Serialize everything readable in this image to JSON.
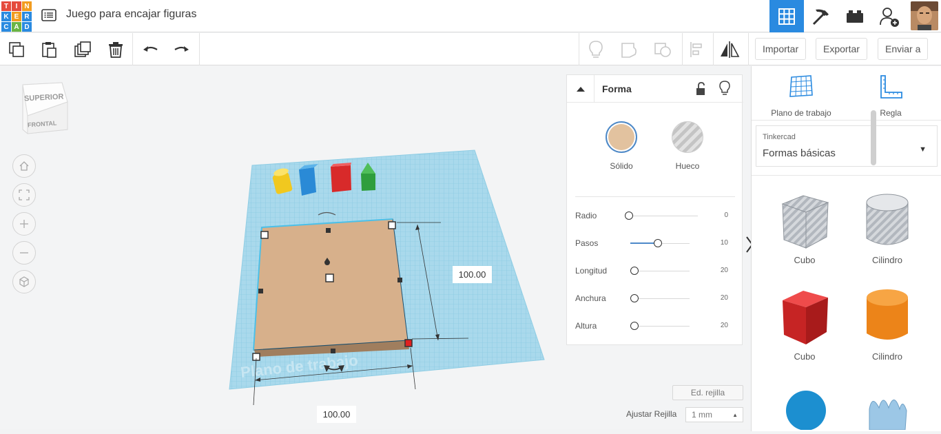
{
  "app": {
    "logo_letters": [
      "T",
      "I",
      "N",
      "K",
      "E",
      "R",
      "C",
      "A",
      "D"
    ],
    "logo_colors": [
      "#e54b3d",
      "#e54b3d",
      "#e54b3d",
      "#2a8ae0",
      "#2a8ae0",
      "#2a8ae0",
      "#2a8ae0",
      "#2a8ae0",
      "#2a8ae0"
    ],
    "title": "Juego para encajar figuras",
    "accent": "#2a8ae0"
  },
  "topbar": {
    "icons": [
      "list-icon",
      "grid-view-icon",
      "pickaxe-icon",
      "bricks-icon",
      "add-user-icon",
      "avatar"
    ]
  },
  "toolbar": {
    "left_icons": [
      "copy-icon",
      "paste-icon",
      "duplicate-icon",
      "delete-icon",
      "undo-icon",
      "redo-icon"
    ],
    "right_icons": [
      "lightbulb-icon",
      "group-icon",
      "ungroup-icon",
      "align-icon",
      "mirror-icon"
    ],
    "import_label": "Importar",
    "export_label": "Exportar",
    "send_label": "Enviar a"
  },
  "viewcube": {
    "top_label": "SUPERIOR",
    "front_label": "FRONTAL"
  },
  "workspace": {
    "plane_label": "Plano de trabajo",
    "width_value": "100.00",
    "length_value": "100.00",
    "shape_color": "#d9b38c"
  },
  "shape_panel": {
    "title": "Forma",
    "solid_label": "Sólido",
    "hole_label": "Hueco",
    "solid_color": "#e2c29f",
    "params": [
      {
        "label": "Radio",
        "value": "0",
        "level": 0.0
      },
      {
        "label": "Pasos",
        "value": "10",
        "level": 0.4
      },
      {
        "label": "Longitud",
        "value": "20",
        "level": 0.06
      },
      {
        "label": "Anchura",
        "value": "20",
        "level": 0.06
      },
      {
        "label": "Altura",
        "value": "20",
        "level": 0.06
      }
    ]
  },
  "grid_controls": {
    "edit_grid_label": "Ed. rejilla",
    "snap_label": "Ajustar Rejilla",
    "snap_value": "1 mm"
  },
  "library": {
    "workplane_label": "Plano de trabajo",
    "ruler_label": "Regla",
    "category_small": "Tinkercad",
    "category": "Formas básicas",
    "shapes": [
      {
        "label": "Cubo",
        "color": "#b8bcc2",
        "kind": "box-hole"
      },
      {
        "label": "Cilindro",
        "color": "#b8bcc2",
        "kind": "cyl-hole"
      },
      {
        "label": "Cubo",
        "color": "#d62f2f",
        "kind": "box"
      },
      {
        "label": "Cilindro",
        "color": "#f08a1f",
        "kind": "cyl"
      }
    ]
  }
}
